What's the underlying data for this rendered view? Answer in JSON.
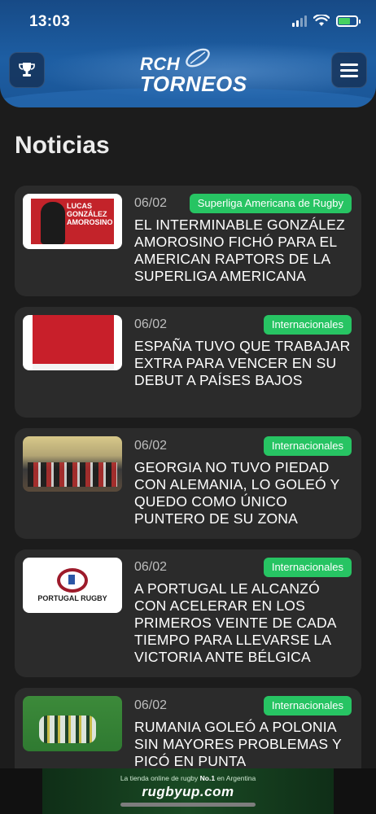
{
  "status_bar": {
    "time": "13:03"
  },
  "header": {
    "logo_line1": "RCH",
    "logo_line2": "TORNEOS"
  },
  "page": {
    "title": "Noticias"
  },
  "news": [
    {
      "date": "06/02",
      "category": "Superliga Americana de Rugby",
      "title": "EL INTERMINABLE GONZÁLEZ AMOROSINO FICHÓ PARA EL AMERICAN RAPTORS DE LA SUPERLIGA AMERICANA",
      "thumb_text": "LUCAS GONZÁLEZ AMOROSINO"
    },
    {
      "date": "06/02",
      "category": "Internacionales",
      "title": "ESPAÑA TUVO QUE TRABAJAR EXTRA PARA VENCER EN SU DEBUT A PAÍSES BAJOS"
    },
    {
      "date": "06/02",
      "category": "Internacionales",
      "title": "GEORGIA NO TUVO PIEDAD CON ALEMANIA, LO GOLEÓ Y QUEDO COMO ÚNICO PUNTERO DE SU ZONA"
    },
    {
      "date": "06/02",
      "category": "Internacionales",
      "title": "A PORTUGAL LE ALCANZÓ CON ACELERAR EN LOS PRIMEROS VEINTE DE CADA TIEMPO PARA LLEVARSE LA VICTORIA ANTE BÉLGICA",
      "thumb_text": "PORTUGAL RUGBY"
    },
    {
      "date": "06/02",
      "category": "Internacionales",
      "title": "RUMANIA GOLEÓ A POLONIA SIN MAYORES PROBLEMAS Y PICÓ EN PUNTA"
    }
  ],
  "ad": {
    "line1_a": "La tienda online de rugby",
    "line1_b": "No.1",
    "line1_c": "en Argentina",
    "brand": "rugbyup.com"
  },
  "colors": {
    "header_blue": "#1d5ea3",
    "badge_green": "#27c463",
    "background": "#1c1c1c",
    "card": "#2b2b2b"
  },
  "icons": [
    "trophy-icon",
    "hamburger-menu-icon",
    "signal-icon",
    "wifi-icon",
    "battery-icon"
  ]
}
